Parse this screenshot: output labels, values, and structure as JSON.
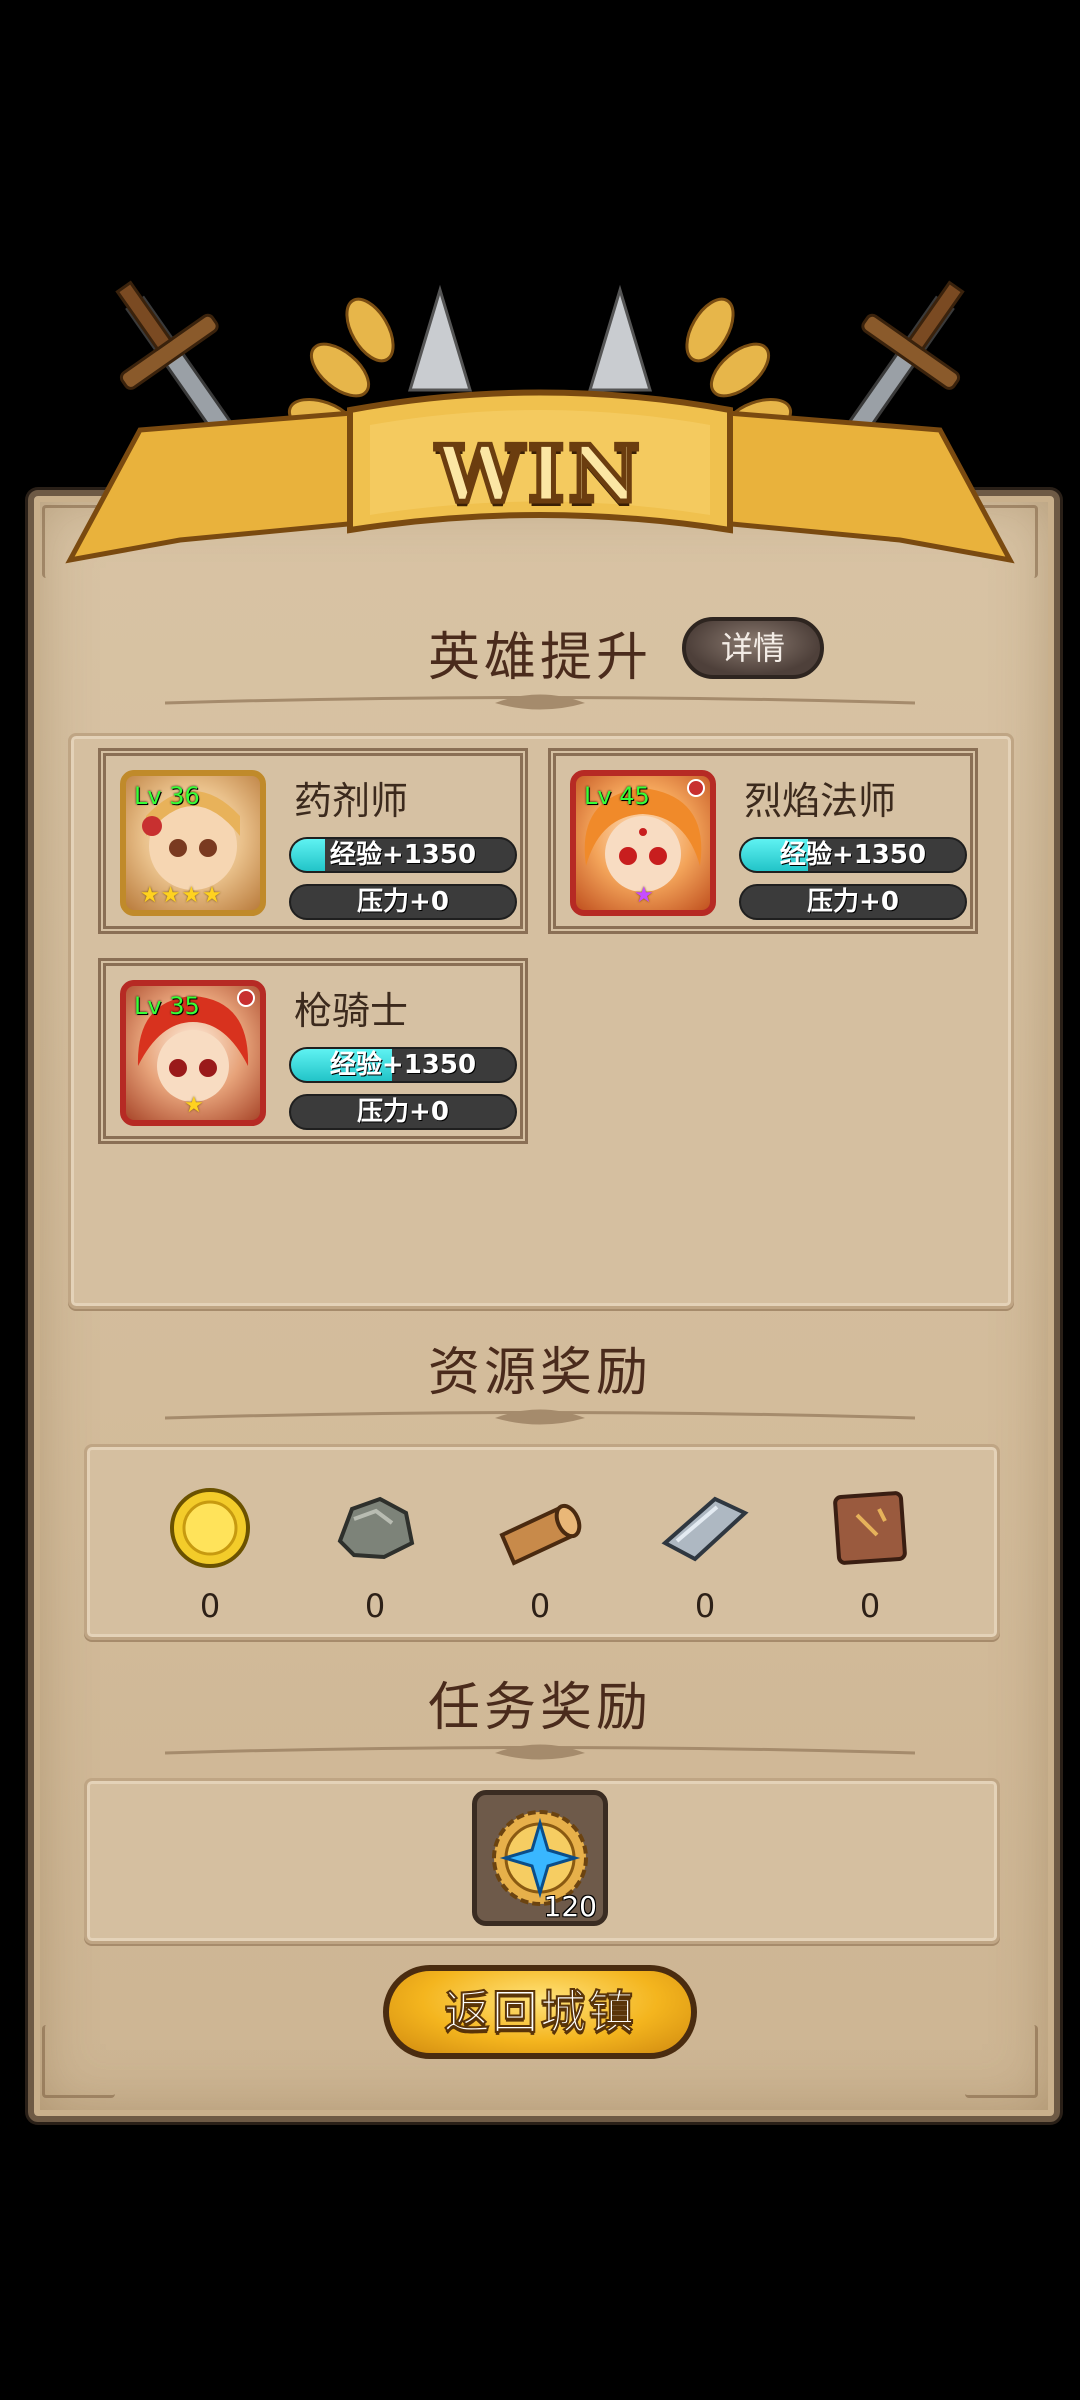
{
  "banner": {
    "title": "WIN"
  },
  "hero_section": {
    "title": "英雄提升",
    "details_label": "详情"
  },
  "heroes": [
    {
      "name": "药剂师",
      "level": "Lv 36",
      "exp_text": "经验+1350",
      "exp_progress": 0.15,
      "stress_text": "压力+0",
      "stars": "★★★★",
      "star_color": "#ffd21f"
    },
    {
      "name": "烈焰法师",
      "level": "Lv 45",
      "exp_text": "经验+1350",
      "exp_progress": 0.3,
      "stress_text": "压力+0",
      "stars": "★",
      "star_color": "#c64cff"
    },
    {
      "name": "枪骑士",
      "level": "Lv 35",
      "exp_text": "经验+1350",
      "exp_progress": 0.45,
      "stress_text": "压力+0",
      "stars": "★",
      "star_color": "#ffd21f"
    }
  ],
  "resource_section": {
    "title": "资源奖励",
    "items": [
      {
        "icon": "gold-coin-icon",
        "count": "0"
      },
      {
        "icon": "stone-ore-icon",
        "count": "0"
      },
      {
        "icon": "wood-log-icon",
        "count": "0"
      },
      {
        "icon": "iron-ingot-icon",
        "count": "0"
      },
      {
        "icon": "leather-hide-icon",
        "count": "0"
      }
    ]
  },
  "task_section": {
    "title": "任务奖励",
    "reward": {
      "icon": "star-medal-icon",
      "count": "120"
    }
  },
  "return_button": {
    "label": "返回城镇"
  }
}
